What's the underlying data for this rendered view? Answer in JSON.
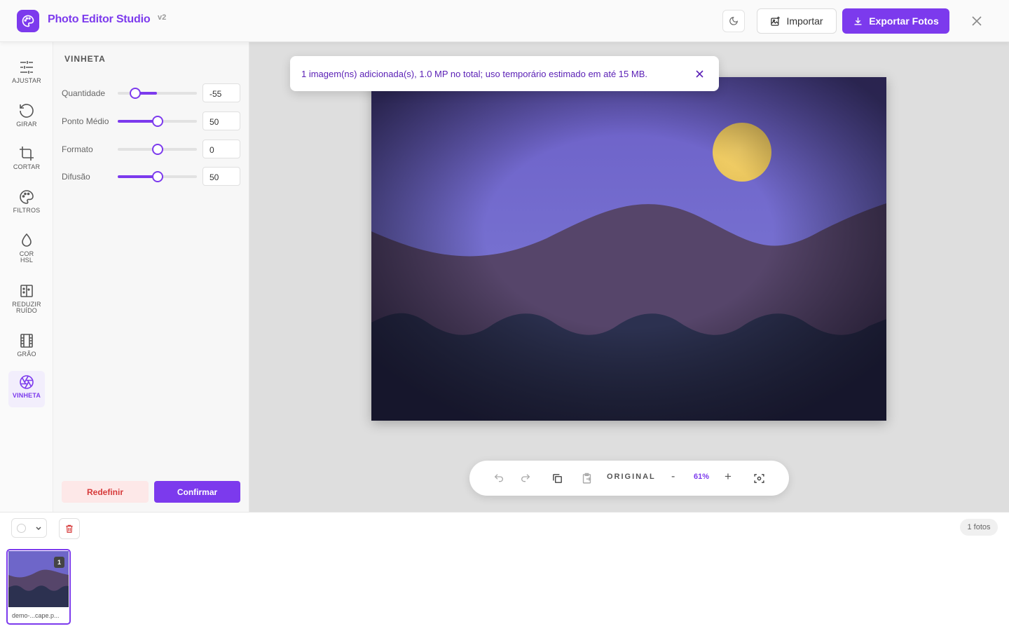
{
  "app": {
    "title": "Photo Editor Studio",
    "version": "v2",
    "accent_color": "#7c3aed"
  },
  "header": {
    "import_label": "Importar",
    "export_label": "Exportar Fotos"
  },
  "tools": [
    {
      "label": "AJUSTAR",
      "icon": "sliders-icon",
      "active": false
    },
    {
      "label": "GIRAR",
      "icon": "rotate-icon",
      "active": false
    },
    {
      "label": "CORTAR",
      "icon": "crop-icon",
      "active": false
    },
    {
      "label": "FILTROS",
      "icon": "palette-icon",
      "active": false
    },
    {
      "label": "COR HSL",
      "icon": "droplet-icon",
      "active": false
    },
    {
      "label": "REDUZIR RUÍDO",
      "icon": "denoise-icon",
      "active": false
    },
    {
      "label": "GRÃO",
      "icon": "film-icon",
      "active": false
    },
    {
      "label": "VINHETA",
      "icon": "aperture-icon",
      "active": true
    }
  ],
  "panel": {
    "title": "VINHETA",
    "controls": [
      {
        "label": "Quantidade",
        "value": "-55",
        "fraction": 0.225,
        "fill_from": 0.225,
        "fill_to": 0.5
      },
      {
        "label": "Ponto Médio",
        "value": "50",
        "fraction": 0.5,
        "fill_from": 0,
        "fill_to": 0.5
      },
      {
        "label": "Formato",
        "value": "0",
        "fraction": 0.5,
        "fill_from": 0.5,
        "fill_to": 0.5
      },
      {
        "label": "Difusão",
        "value": "50",
        "fraction": 0.5,
        "fill_from": 0,
        "fill_to": 0.5
      }
    ],
    "reset_label": "Redefinir",
    "confirm_label": "Confirmar"
  },
  "toast": {
    "message": "1 imagem(ns) adicionada(s), 1.0 MP no total; uso temporário estimado em até 15 MB."
  },
  "zoombar": {
    "original_label": "ORIGINAL",
    "minus": "-",
    "zoom_level": "61%",
    "plus": "+"
  },
  "strip": {
    "photo_count": "1 fotos",
    "thumbnails": [
      {
        "name": "demo-...cape.p...",
        "badge": "1"
      }
    ]
  }
}
